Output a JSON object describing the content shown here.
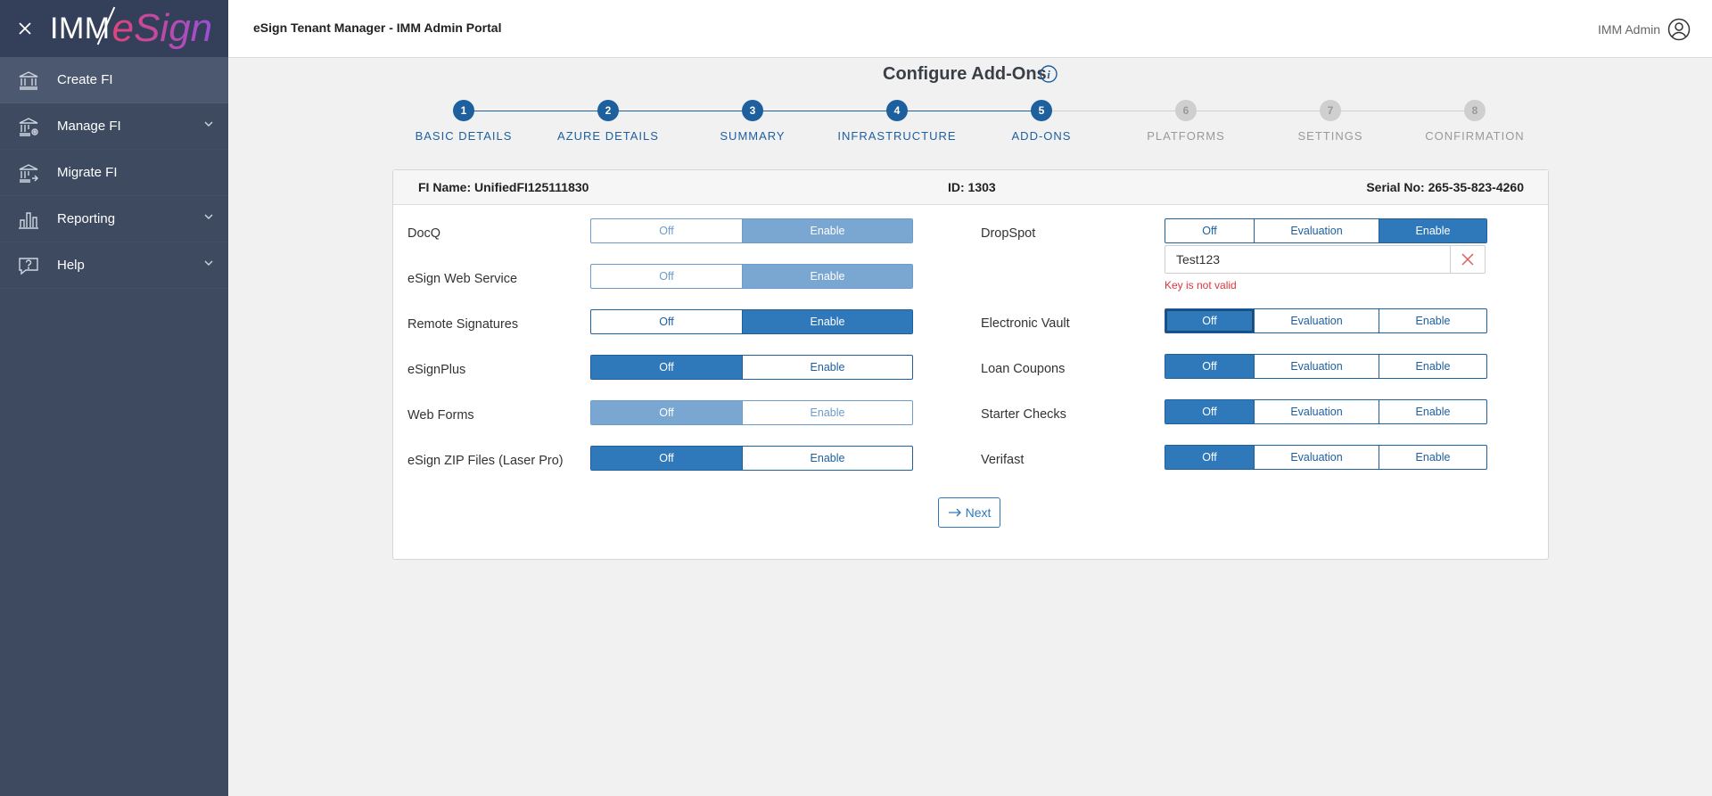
{
  "sidebar": {
    "logo": {
      "part1": "IMM",
      "part2": "eSign"
    },
    "items": [
      {
        "label": "Create FI",
        "icon": "bank-icon",
        "active": true,
        "expandable": false
      },
      {
        "label": "Manage FI",
        "icon": "bank-settings-icon",
        "active": false,
        "expandable": true
      },
      {
        "label": "Migrate FI",
        "icon": "bank-migrate-icon",
        "active": false,
        "expandable": false
      },
      {
        "label": "Reporting",
        "icon": "bar-chart-icon",
        "active": false,
        "expandable": true
      },
      {
        "label": "Help",
        "icon": "help-icon",
        "active": false,
        "expandable": true
      }
    ]
  },
  "header": {
    "title": "eSign Tenant Manager - IMM Admin Portal",
    "user_name": "IMM Admin"
  },
  "page": {
    "title": "Configure Add-Ons"
  },
  "stepper": {
    "steps": [
      {
        "num": "1",
        "label": "BASIC DETAILS",
        "complete": true
      },
      {
        "num": "2",
        "label": "AZURE DETAILS",
        "complete": true
      },
      {
        "num": "3",
        "label": "SUMMARY",
        "complete": true
      },
      {
        "num": "4",
        "label": "INFRASTRUCTURE",
        "complete": true
      },
      {
        "num": "5",
        "label": "ADD-ONS",
        "complete": true
      },
      {
        "num": "6",
        "label": "PLATFORMS",
        "complete": false
      },
      {
        "num": "7",
        "label": "SETTINGS",
        "complete": false
      },
      {
        "num": "8",
        "label": "CONFIRMATION",
        "complete": false
      }
    ]
  },
  "card": {
    "fi_name": "FI Name: UnifiedFI125111830",
    "id": "ID: 1303",
    "serial": "Serial No: 265-35-823-4260"
  },
  "left_addons": [
    {
      "label": "DocQ",
      "options": [
        "Off",
        "Enable"
      ],
      "selected": "Enable",
      "disabled": true
    },
    {
      "label": "eSign Web Service",
      "options": [
        "Off",
        "Enable"
      ],
      "selected": "Enable",
      "disabled": true
    },
    {
      "label": "Remote Signatures",
      "options": [
        "Off",
        "Enable"
      ],
      "selected": "Enable",
      "disabled": false
    },
    {
      "label": "eSignPlus",
      "options": [
        "Off",
        "Enable"
      ],
      "selected": "Off",
      "disabled": false
    },
    {
      "label": "Web Forms",
      "options": [
        "Off",
        "Enable"
      ],
      "selected": "Off",
      "disabled": true
    },
    {
      "label": "eSign ZIP Files (Laser Pro)",
      "options": [
        "Off",
        "Enable"
      ],
      "selected": "Off",
      "disabled": false
    }
  ],
  "right_addons": [
    {
      "label": "DropSpot",
      "options": [
        "Off",
        "Evaluation",
        "Enable"
      ],
      "selected": "Enable",
      "disabled": false
    },
    {
      "label": "Electronic Vault",
      "options": [
        "Off",
        "Evaluation",
        "Enable"
      ],
      "selected": "Off",
      "disabled": false,
      "focused": true
    },
    {
      "label": "Loan Coupons",
      "options": [
        "Off",
        "Evaluation",
        "Enable"
      ],
      "selected": "Off",
      "disabled": false
    },
    {
      "label": "Starter Checks",
      "options": [
        "Off",
        "Evaluation",
        "Enable"
      ],
      "selected": "Off",
      "disabled": false
    },
    {
      "label": "Verifast",
      "options": [
        "Off",
        "Evaluation",
        "Enable"
      ],
      "selected": "Off",
      "disabled": false
    }
  ],
  "dropspot_key": {
    "value": "Test123",
    "error": "Key is not valid"
  },
  "actions": {
    "next_label": "Next"
  },
  "colors": {
    "sidebar_bg": "#3d4a60",
    "primary": "#1e5f9e",
    "selected": "#2f79bb",
    "error": "#d9363e"
  }
}
